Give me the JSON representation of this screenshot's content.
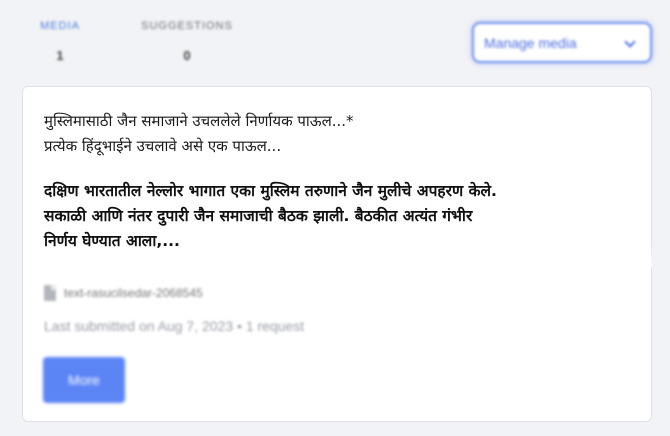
{
  "stats": {
    "media": {
      "label": "MEDIA",
      "count": "1"
    },
    "suggestions": {
      "label": "SUGGESTIONS",
      "count": "0"
    }
  },
  "manage_media": {
    "label": "Manage media"
  },
  "card": {
    "teaser": "मुस्लिमासाठी जैन समाजाने उचललेले निर्णायक पाऊल...*\nप्रत्येक हिंदूभाईने उचलावे असे एक पाऊल...",
    "body": "दक्षिण भारतातील नेल्लोर भागात एका मुस्लिम तरुणाने जैन मुलीचे अपहरण केले.\nसकाळी आणि नंतर दुपारी जैन समाजाची बैठक झाली. बैठकीत अत्यंत गंभीर\nनिर्णय घेण्यात आला,...",
    "file_name": "text-rasucilsedar-2068545",
    "submitted": "Last submitted on Aug 7, 2023  •  1 request",
    "more_label": "More"
  },
  "colors": {
    "accent": "#5b84f5",
    "background": "#f2f3f6"
  }
}
